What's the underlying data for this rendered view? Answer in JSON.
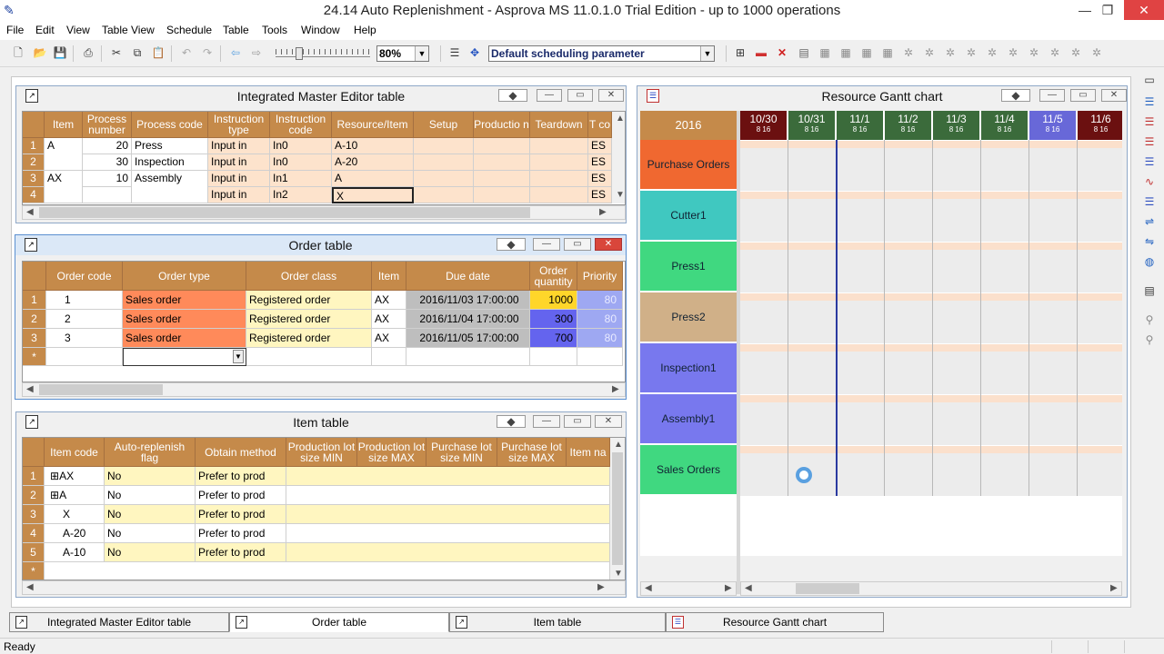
{
  "app": {
    "title": "24.14 Auto Replenishment - Asprova MS 11.0.1.0 Trial Edition  - up to 1000 operations",
    "icon": "feather-pen-icon"
  },
  "menu": [
    "File",
    "Edit",
    "View",
    "Table View",
    "Schedule",
    "Table",
    "Tools",
    "Window",
    "Help"
  ],
  "toolbar": {
    "zoom": "80%",
    "param": "Default scheduling parameter"
  },
  "ime": {
    "title": "Integrated Master Editor table",
    "headers": [
      "Item",
      "Process number",
      "Process code",
      "Instruction type",
      "Instruction code",
      "Resource/Item",
      "Setup",
      "Productio n",
      "Teardown",
      "T co"
    ],
    "rows": [
      {
        "n": "1",
        "item": "A",
        "pn": "20",
        "pc": "Press",
        "it": "Input in",
        "ic": "In0",
        "ri": "A-10",
        "t": "ES"
      },
      {
        "n": "2",
        "item": "",
        "pn": "30",
        "pc": "Inspection",
        "it": "Input in",
        "ic": "In0",
        "ri": "A-20",
        "t": "ES"
      },
      {
        "n": "3",
        "item": "AX",
        "pn": "10",
        "pc": "Assembly",
        "it": "Input in",
        "ic": "In1",
        "ri": "A",
        "t": "ES"
      },
      {
        "n": "4",
        "item": "",
        "pn": "",
        "pc": "",
        "it": "Input in",
        "ic": "In2",
        "ri": "X",
        "t": "ES"
      }
    ]
  },
  "order": {
    "title": "Order table",
    "headers": [
      "Order code",
      "Order type",
      "Order class",
      "Item",
      "Due date",
      "Order quantity",
      "Priority"
    ],
    "rows": [
      {
        "n": "1",
        "code": "1",
        "type": "Sales order",
        "cls": "Registered order",
        "item": "AX",
        "due": "2016/11/03 17:00:00",
        "qty": "1000",
        "pri": "80"
      },
      {
        "n": "2",
        "code": "2",
        "type": "Sales order",
        "cls": "Registered order",
        "item": "AX",
        "due": "2016/11/04 17:00:00",
        "qty": "300",
        "pri": "80"
      },
      {
        "n": "3",
        "code": "3",
        "type": "Sales order",
        "cls": "Registered order",
        "item": "AX",
        "due": "2016/11/05 17:00:00",
        "qty": "700",
        "pri": "80"
      }
    ],
    "newrow": "*"
  },
  "item": {
    "title": "Item table",
    "headers": [
      "Item code",
      "Auto-replenish flag",
      "Obtain method",
      "Production lot size MIN",
      "Production lot size MAX",
      "Purchase lot size MIN",
      "Purchase lot size MAX",
      "Item na"
    ],
    "rows": [
      {
        "n": "1",
        "code": "AX",
        "exp": "⊞",
        "ar": "No",
        "om": "Prefer to prod"
      },
      {
        "n": "2",
        "code": "A",
        "exp": "⊞",
        "ar": "No",
        "om": "Prefer to prod"
      },
      {
        "n": "3",
        "code": "X",
        "exp": "",
        "ar": "No",
        "om": "Prefer to prod"
      },
      {
        "n": "4",
        "code": "A-20",
        "exp": "",
        "ar": "No",
        "om": "Prefer to prod"
      },
      {
        "n": "5",
        "code": "A-10",
        "exp": "",
        "ar": "No",
        "om": "Prefer to prod"
      }
    ],
    "newrow": "*"
  },
  "gantt": {
    "title": "Resource Gantt chart",
    "year": "2016",
    "dates": [
      {
        "d": "10/30",
        "s": "8  16",
        "c": "#6b1010"
      },
      {
        "d": "10/31",
        "s": "8  16",
        "c": "#3b6b3b"
      },
      {
        "d": "11/1",
        "s": "8  16",
        "c": "#3b6b3b"
      },
      {
        "d": "11/2",
        "s": "8  16",
        "c": "#3b6b3b"
      },
      {
        "d": "11/3",
        "s": "8  16",
        "c": "#3b6b3b"
      },
      {
        "d": "11/4",
        "s": "8  16",
        "c": "#3b6b3b"
      },
      {
        "d": "11/5",
        "s": "8  16",
        "c": "#6868d8"
      },
      {
        "d": "11/6",
        "s": "8  16",
        "c": "#6b1010"
      }
    ],
    "resources": [
      {
        "name": "Purchase Orders",
        "c": "#f06830"
      },
      {
        "name": "Cutter1",
        "c": "#40c8c0"
      },
      {
        "name": "Press1",
        "c": "#40d880"
      },
      {
        "name": "Press2",
        "c": "#d0b088"
      },
      {
        "name": "Inspection1",
        "c": "#7878ee"
      },
      {
        "name": "Assembly1",
        "c": "#7878ee"
      },
      {
        "name": "Sales Orders",
        "c": "#40d880"
      }
    ]
  },
  "tabs": [
    "Integrated Master Editor table",
    "Order table",
    "Item table",
    "Resource Gantt chart"
  ],
  "status": "Ready"
}
